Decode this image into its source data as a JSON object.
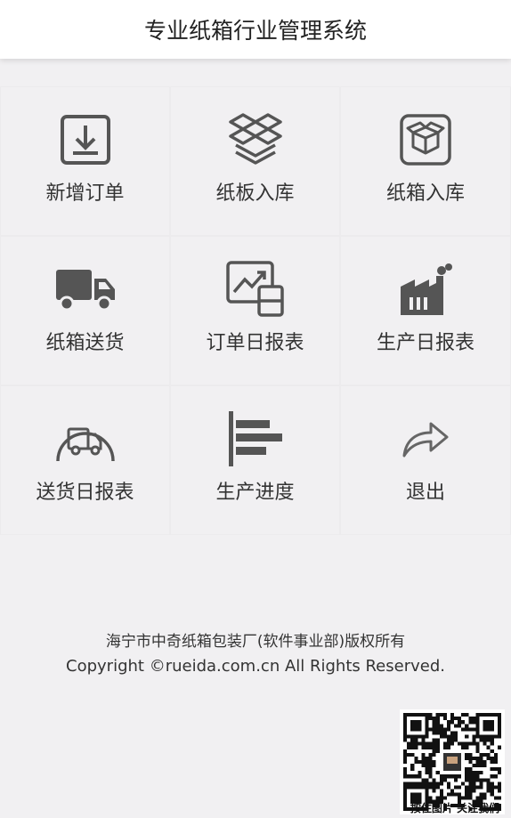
{
  "header": {
    "title": "专业纸箱行业管理系统"
  },
  "menu": [
    {
      "label": "新增订单",
      "icon": "download-tray-icon"
    },
    {
      "label": "纸板入库",
      "icon": "layered-boxes-icon"
    },
    {
      "label": "纸箱入库",
      "icon": "open-box-icon"
    },
    {
      "label": "纸箱送货",
      "icon": "truck-icon"
    },
    {
      "label": "订单日报表",
      "icon": "chart-report-icon"
    },
    {
      "label": "生产日报表",
      "icon": "factory-icon"
    },
    {
      "label": "送货日报表",
      "icon": "delivery-truck-circle-icon"
    },
    {
      "label": "生产进度",
      "icon": "progress-bars-icon"
    },
    {
      "label": "退出",
      "icon": "share-arrow-icon"
    }
  ],
  "footer": {
    "owner": "海宁市中奇纸箱包装厂(软件事业部)版权所有",
    "copyright": "Copyright ©rueida.com.cn All Rights Reserved."
  },
  "qr": {
    "caption": "按住图片 关注我们"
  },
  "colors": {
    "icon": "#555555",
    "background": "#f1f0f2",
    "header_bg": "#ffffff"
  }
}
